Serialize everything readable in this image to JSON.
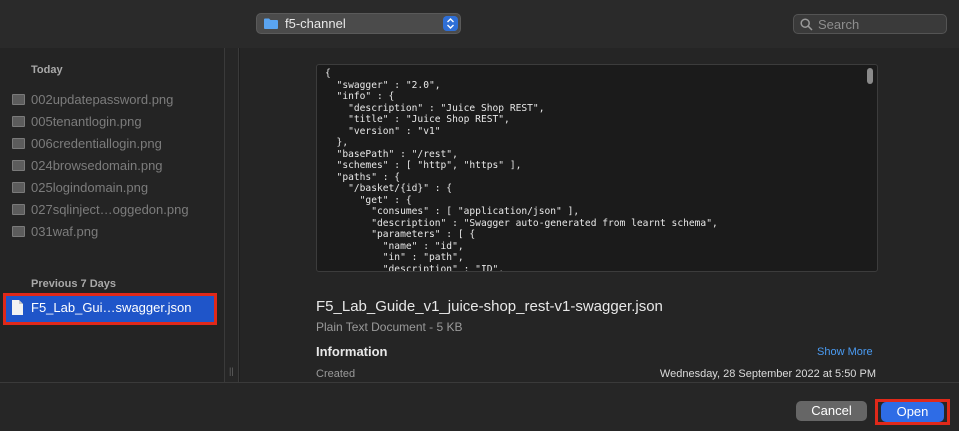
{
  "toolbar": {
    "folder_name": "f5-channel",
    "search_placeholder": "Search"
  },
  "sidebar": {
    "today_label": "Today",
    "today_items": [
      {
        "name": "002updatepassword.png"
      },
      {
        "name": "005tenantlogin.png"
      },
      {
        "name": "006credentiallogin.png"
      },
      {
        "name": "024browsedomain.png"
      },
      {
        "name": "025logindomain.png"
      },
      {
        "name": "027sqlinject…oggedon.png"
      },
      {
        "name": "031waf.png"
      }
    ],
    "previous_label": "Previous 7 Days",
    "selected_item": "F5_Lab_Gui…swagger.json"
  },
  "preview": {
    "code": "{\n  \"swagger\" : \"2.0\",\n  \"info\" : {\n    \"description\" : \"Juice Shop REST\",\n    \"title\" : \"Juice Shop REST\",\n    \"version\" : \"v1\"\n  },\n  \"basePath\" : \"/rest\",\n  \"schemes\" : [ \"http\", \"https\" ],\n  \"paths\" : {\n    \"/basket/{id}\" : {\n      \"get\" : {\n        \"consumes\" : [ \"application/json\" ],\n        \"description\" : \"Swagger auto-generated from learnt schema\",\n        \"parameters\" : [ {\n          \"name\" : \"id\",\n          \"in\" : \"path\",\n          \"description\" : \"ID\",\n          \"required\" : true,",
    "file_title": "F5_Lab_Guide_v1_juice-shop_rest-v1-swagger.json",
    "file_kind": "Plain Text Document - 5 KB",
    "info_heading": "Information",
    "show_more": "Show More",
    "created_label": "Created",
    "created_value": "Wednesday, 28 September 2022 at 5:50 PM"
  },
  "footer": {
    "cancel_label": "Cancel",
    "open_label": "Open"
  },
  "colors": {
    "accent": "#2e6ce6",
    "selection": "#1f55c9",
    "highlight_outline": "#e0291a",
    "link": "#4a9bf2"
  }
}
